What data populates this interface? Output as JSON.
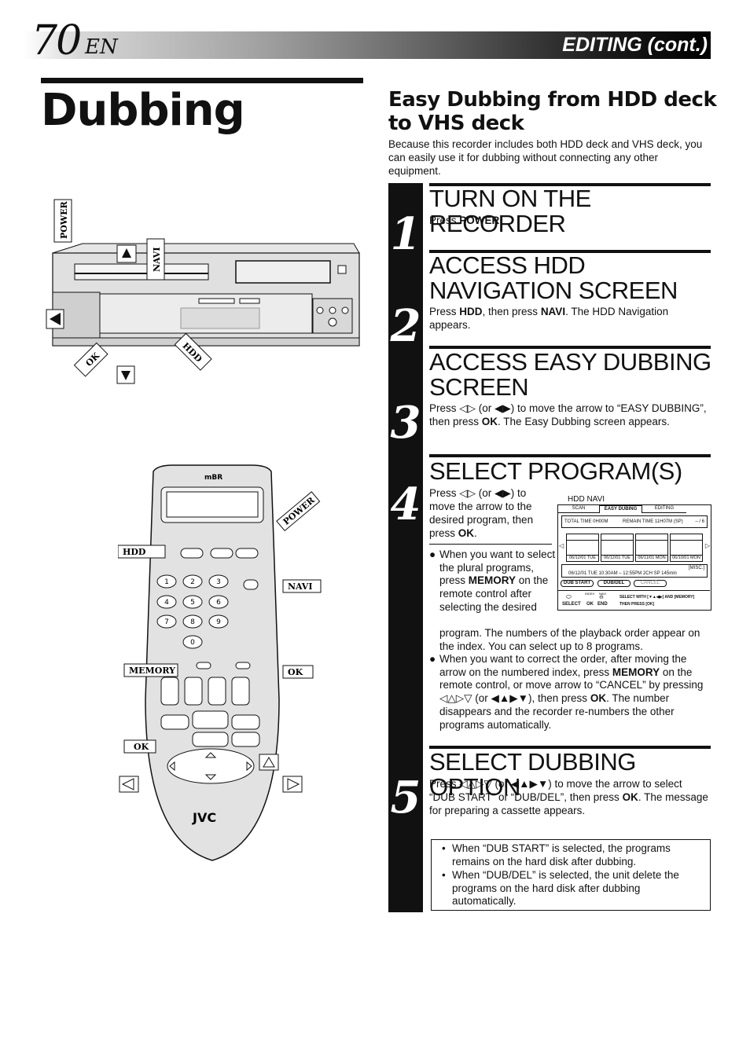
{
  "header": {
    "page_number": "70",
    "language": "EN",
    "section": "EDITING (cont.)"
  },
  "title": "Dubbing",
  "subsection": {
    "title": "Easy Dubbing from HDD deck to VHS deck",
    "intro": "Because this recorder includes both HDD deck and VHS deck, you can easily use it for dubbing without connecting any other equipment."
  },
  "steps": [
    {
      "number": "1",
      "heading": "TURN ON THE RECORDER",
      "text_parts": [
        "Press ",
        "POWER",
        "."
      ]
    },
    {
      "number": "2",
      "heading_line1": "ACCESS HDD",
      "heading_line2": "NAVIGATION SCREEN",
      "text_parts": [
        "Press ",
        "HDD",
        ", then press ",
        "NAVI",
        ". The HDD Navigation appears."
      ]
    },
    {
      "number": "3",
      "heading_line1": "ACCESS EASY DUBBING",
      "heading_line2": "SCREEN",
      "text_parts": [
        "Press ◁▷ (or ◀▶) to move the arrow to “EASY DUBBING”, then press ",
        "OK",
        ". The Easy Dubbing screen appears."
      ]
    },
    {
      "number": "4",
      "heading": "SELECT PROGRAM(S)",
      "text_parts": [
        "Press ◁▷ (or ◀▶) to move the arrow to the desired program, then press ",
        "OK",
        "."
      ],
      "bullets": [
        {
          "parts": [
            "When you want to select the plural programs, press ",
            "MEMORY",
            " on the remote control after selecting the desired program. The numbers of the playback order appear on the index. You can select up to 8 programs."
          ]
        },
        {
          "parts": [
            "When you want to correct the order, after moving the arrow on the numbered index, press ",
            "MEMORY",
            " on the remote control, or move arrow to “CANCEL” by pressing ◁△▷▽ (or ◀▲▶▼), then press ",
            "OK",
            ". The number disappears and the recorder re-numbers the other programs automatically."
          ]
        }
      ]
    },
    {
      "number": "5",
      "heading": "SELECT DUBBING OPTION",
      "text_parts": [
        "Press ◁△▷▽ (or ◀▲▶▼) to move the arrow to select “DUB START” or “DUB/DEL”, then press ",
        "OK",
        ". The message for preparing a cassette appears."
      ],
      "notes": [
        "When “DUB START” is selected, the programs remains on the hard disk after dubbing.",
        "When “DUB/DEL” is selected, the unit delete the programs on the hard disk after dubbing automatically."
      ]
    }
  ],
  "navi_screen": {
    "label": "HDD NAVI",
    "tabs": [
      "SCAN",
      "EASY DUBING",
      "EDITING"
    ],
    "active_tab": "EASY DUBING",
    "status": {
      "total_time": "TOTAL TIME  0H00M",
      "remain_time": "REMAIN TIME 11H07M (SP)",
      "count": "– / 6"
    },
    "thumbnails": [
      "06/12/01 TUE",
      "06/12/01 TUE",
      "06/11/01 MON",
      "06/10/01 MON"
    ],
    "info": {
      "category": "[MISC.]",
      "detail": "06/12/01 TUE 10:30AM – 12:55PM   2CH   SP  145min"
    },
    "buttons": [
      "DUB START",
      "DUB/DEL",
      "CANCEL"
    ],
    "footer": {
      "select": "SELECT",
      "ok": "OK",
      "end": "END",
      "index_label": "INDEX",
      "navi_label": "NAVI",
      "instruction_line1": "SELECT WITH  [▼▲◀▶] AND [MEMORY]",
      "instruction_line2": "THEN PRESS   [OK]"
    }
  },
  "vcr_illustration": {
    "callouts": [
      "POWER",
      "NAVI",
      "OK",
      "HDD"
    ],
    "arrows": [
      "up",
      "down",
      "left"
    ]
  },
  "remote_illustration": {
    "brand": "JVC",
    "logo": "MBR",
    "callouts": [
      "POWER",
      "HDD",
      "NAVI",
      "MEMORY",
      "OK",
      "OK"
    ],
    "keypad": [
      "1",
      "2",
      "3",
      "4",
      "5",
      "6",
      "7",
      "8",
      "9",
      "0"
    ]
  }
}
